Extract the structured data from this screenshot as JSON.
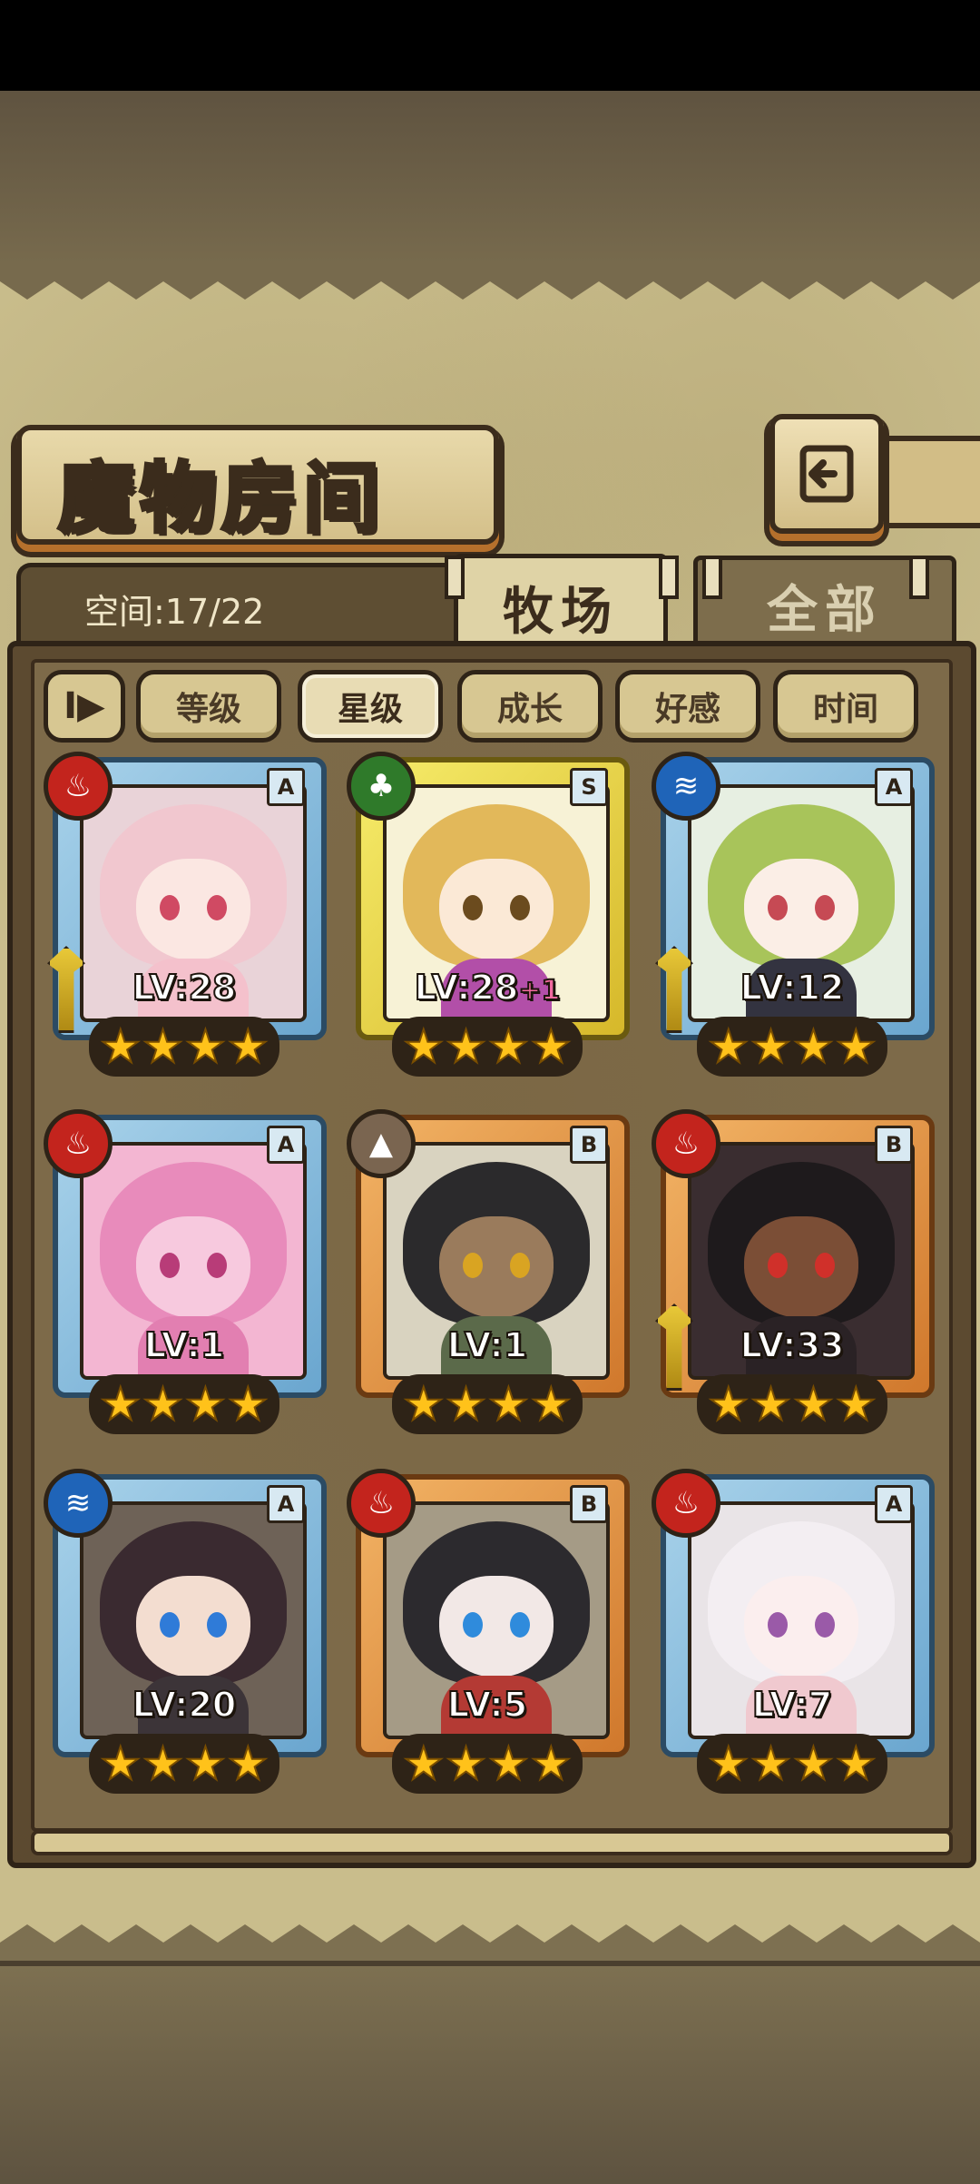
{
  "screen": {
    "title": "魔物房间",
    "back_icon": "back-arrow-icon",
    "capacity": "空间:17/22"
  },
  "tabs": [
    {
      "label": "牧场",
      "active": true
    },
    {
      "label": "全部",
      "active": false
    }
  ],
  "sort": {
    "toggle_label": "I▶",
    "options": [
      {
        "label": "等级",
        "active": false
      },
      {
        "label": "星级",
        "active": true
      },
      {
        "label": "成长",
        "active": false
      },
      {
        "label": "好感",
        "active": false
      },
      {
        "label": "时间",
        "active": false
      }
    ]
  },
  "monsters": [
    {
      "element": "fire",
      "element_icon": "flame-icon",
      "rank": "A",
      "lv_text": "LV:28",
      "plus": "",
      "stars": 4,
      "weapon": true
    },
    {
      "element": "grass",
      "element_icon": "leaf-icon",
      "rank": "S",
      "lv_text": "LV:28",
      "plus": "+1",
      "stars": 4,
      "weapon": false
    },
    {
      "element": "water",
      "element_icon": "wave-icon",
      "rank": "A",
      "lv_text": "LV:12",
      "plus": "",
      "stars": 4,
      "weapon": true
    },
    {
      "element": "fire",
      "element_icon": "flame-icon",
      "rank": "A",
      "lv_text": "LV:1",
      "plus": "",
      "stars": 4,
      "weapon": false
    },
    {
      "element": "earth",
      "element_icon": "mountain-icon",
      "rank": "B",
      "lv_text": "LV:1",
      "plus": "",
      "stars": 4,
      "weapon": false
    },
    {
      "element": "fire",
      "element_icon": "flame-icon",
      "rank": "B",
      "lv_text": "LV:33",
      "plus": "",
      "stars": 4,
      "weapon": true
    },
    {
      "element": "water",
      "element_icon": "wave-icon",
      "rank": "A",
      "lv_text": "LV:20",
      "plus": "",
      "stars": 4,
      "weapon": false
    },
    {
      "element": "fire",
      "element_icon": "flame-icon",
      "rank": "B",
      "lv_text": "LV:5",
      "plus": "",
      "stars": 4,
      "weapon": false
    },
    {
      "element": "fire",
      "element_icon": "flame-icon",
      "rank": "A",
      "lv_text": "LV:7",
      "plus": "",
      "stars": 4,
      "weapon": false
    }
  ],
  "colors": {
    "frame_blue": "#6aa6cf",
    "frame_gold": "#d6b82a",
    "frame_bronze": "#d0782c",
    "star": "#ffc21a"
  }
}
